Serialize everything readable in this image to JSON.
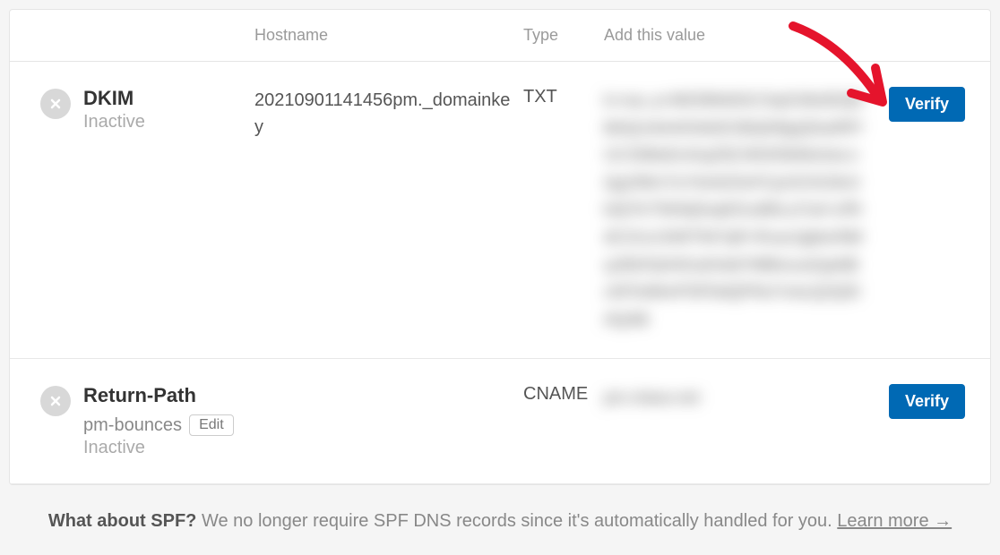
{
  "headers": {
    "hostname": "Hostname",
    "type": "Type",
    "value": "Add this value"
  },
  "records": [
    {
      "name": "DKIM",
      "status": "Inactive",
      "hostname": "20210901141456pm._domainkey",
      "type": "TXT",
      "value_placeholder": "k=rsa; p=MIGfMA0GCSqGSIb3DQEBAQUAA4GNADCBiQKBgQDwIRP/UC3SBsEmGqZ9ZJW3/DkMoGeLnQg1fWn7/zYtIxN2SnFCjxOCKG9v3b4jYfcTNh5ijSsq631uBItLa7od+v/RtdC2UzJ1lWT947qR+Rcac2gbto/NMqJ0fzfVjH4OuKhitdY9tf6mcwGjaNBcWToIMmPSPDdQPNUYckcQ2QIDAQAB",
      "verify_label": "Verify"
    },
    {
      "name": "Return-Path",
      "status": "Inactive",
      "hostname": "pm-bounces",
      "edit_label": "Edit",
      "type": "CNAME",
      "value_placeholder": "pm.mtasv.net",
      "verify_label": "Verify"
    }
  ],
  "footer": {
    "strong": "What about SPF?",
    "body": " We no longer require SPF DNS records since it's automatically handled for you. ",
    "link_text": "Learn more →"
  }
}
